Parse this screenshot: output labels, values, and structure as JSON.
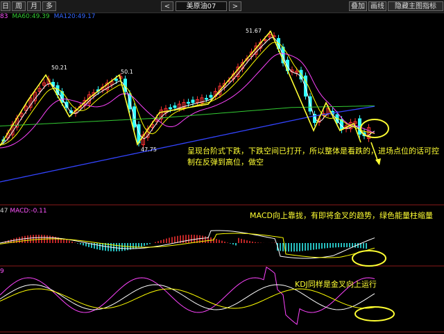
{
  "toolbar": {
    "left_buttons": [
      "日",
      "周",
      "月",
      "多"
    ],
    "prev": "<",
    "symbol": "美原油07",
    "next": ">",
    "right_buttons": [
      "叠加",
      "画线",
      "隐藏主图指标"
    ]
  },
  "ma_legend": [
    {
      "text": "83",
      "color": "#ff55ff"
    },
    {
      "text": "MA60:49.39",
      "color": "#33cc33"
    },
    {
      "text": "MA120:49.17",
      "color": "#3366ff"
    }
  ],
  "price_labels": {
    "h1": "50.21",
    "h2": "50.1",
    "low": "47.75",
    "high": "51.67"
  },
  "annotations": {
    "main_line1": "呈现台阶式下跌，下跌空间已打开，所以整体是看跌的，进场点位的话可控",
    "main_line2": "制在反弹到高位，做空",
    "macd": "MACD向上靠拢，有即将金叉的趋势，绿色能量柱缩量",
    "kdj": "KDJ同样是金叉向上运行"
  },
  "indicators": {
    "macd_prefix": "47",
    "macd_value": "MACD:-0.11",
    "kdj_prefix": "9"
  },
  "colors": {
    "up": "#ff3333",
    "down": "#33ffff",
    "ma_short": "#ffffff",
    "ma_yellow": "#ffff00",
    "ma_magenta": "#ff44ff",
    "ma60": "#33cc33",
    "ma120": "#3344ff",
    "annot": "#ffff33"
  }
}
